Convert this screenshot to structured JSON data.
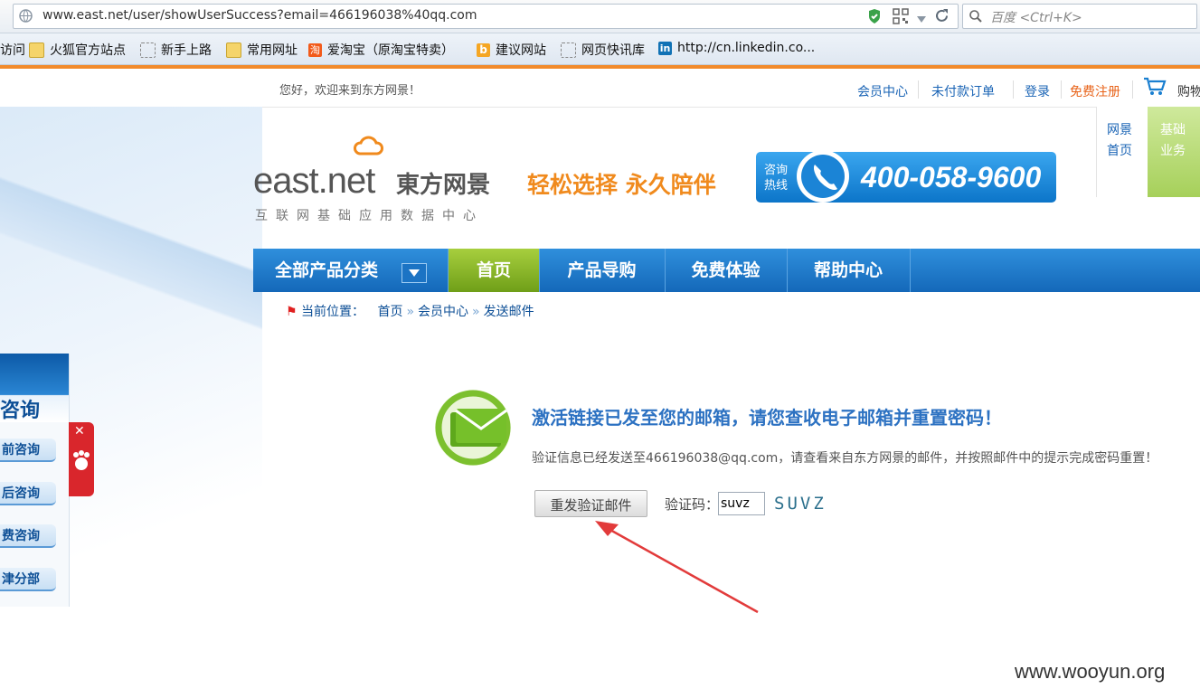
{
  "browser": {
    "url": "www.east.net/user/showUserSuccess?email=466196038%40qq.com",
    "search_placeholder": "百度 <Ctrl+K>",
    "bookmarks": [
      {
        "label": "访问",
        "icon": "none"
      },
      {
        "label": "火狐官方站点",
        "icon": "folder-icon"
      },
      {
        "label": "新手上路",
        "icon": "blank-page-icon"
      },
      {
        "label": "常用网址",
        "icon": "folder-icon"
      },
      {
        "label": "爱淘宝（原淘宝特卖）",
        "icon": "taobao-icon"
      },
      {
        "label": "建议网站",
        "icon": "bing-icon"
      },
      {
        "label": "网页快讯库",
        "icon": "blank-page-icon"
      },
      {
        "label": "http://cn.linkedin.co...",
        "icon": "linkedin-icon"
      }
    ]
  },
  "topbar": {
    "welcome": "您好，欢迎来到东方网景！",
    "links": {
      "member_center": "会员中心",
      "unpaid_orders": "未付款订单",
      "login": "登录",
      "register": "免费注册",
      "cart": "购物"
    }
  },
  "header": {
    "logo_east": "east.net",
    "logo_cn": "東方网景",
    "logo_sub": "互联网基础应用数据中心",
    "slogan": "轻松选择  永久陪伴",
    "hotline_label": "咨询热线",
    "hotline_number": "400-058-9600",
    "right_home": "网景首页",
    "right_basic": "基础业务"
  },
  "nav": {
    "items": [
      "全部产品分类",
      "首页",
      "产品导购",
      "免费体验",
      "帮助中心"
    ]
  },
  "breadcrumb": {
    "label": "当前位置：",
    "items": [
      "首页",
      "会员中心",
      "发送邮件"
    ]
  },
  "consult": {
    "title": "咨询",
    "items": [
      "前咨询",
      "后咨询",
      "费咨询",
      "津分部"
    ]
  },
  "content": {
    "title": "激活链接已发至您的邮箱，请您查收电子邮箱并重置密码！",
    "body": "验证信息已经发送至466196038@qq.com，请查看来自东方网景的邮件，并按照邮件中的提示完成密码重置！",
    "resend_button": "重发验证邮件",
    "captcha_label": "验证码：",
    "captcha_value": "suvz",
    "captcha_image_text": "SUVZ"
  },
  "watermark": "www.wooyun.org",
  "colors": {
    "accent_orange": "#f28a2b",
    "nav_blue": "#1468b9",
    "nav_home_green": "#7fae1f",
    "title_blue": "#2d72c2",
    "annotation_arrow": "#e23b3b"
  }
}
